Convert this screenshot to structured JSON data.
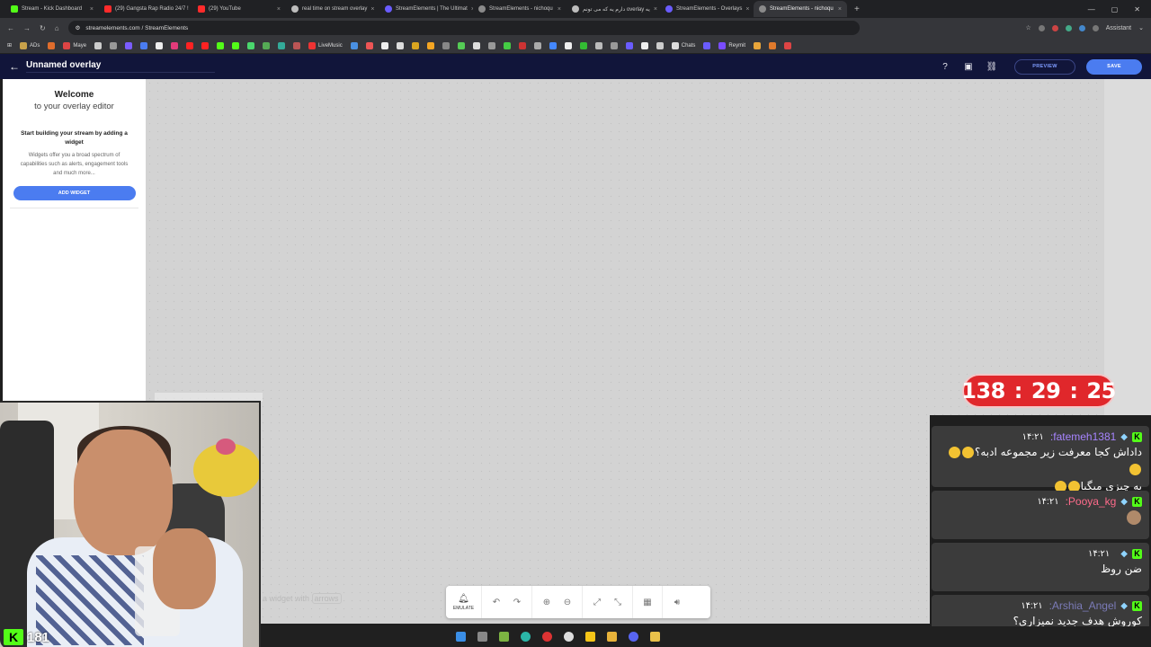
{
  "browser": {
    "tabs": [
      {
        "label": "Stream - Kick Dashboard",
        "color": "#53fc18"
      },
      {
        "label": "(29) Gangsta Rap Radio 24/7 !",
        "color": "#ff2b2b"
      },
      {
        "label": "(29) YouTube",
        "color": "#ff2b2b"
      },
      {
        "label": "real time on stream overlay",
        "color": "#bdbdbd"
      },
      {
        "label": "StreamElements | The Ultimat",
        "color": "#6a5cff"
      },
      {
        "label": "StreamElements - nichoqu",
        "color": "#8a8a8a"
      },
      {
        "label": "دارم یه که می تونم overlay يه",
        "color": "#bdbdbd"
      },
      {
        "label": "StreamElements - Overlays",
        "color": "#6a5cff"
      },
      {
        "label": "StreamElements - nichoqu",
        "color": "#8a8a8a"
      }
    ],
    "active_tab": 8,
    "url": "streamelements.com / StreamElements",
    "assistant_label": "Assistant",
    "bookmarks": [
      "ADs",
      "Maye",
      "LiveMusic",
      "Chats",
      "Reymit"
    ]
  },
  "app": {
    "overlay_name": "Unnamed overlay",
    "preview_label": "PREVIEW",
    "save_label": "SAVE"
  },
  "panel": {
    "welcome_title": "Welcome",
    "welcome_sub": "to your overlay editor",
    "heading": "Start building your stream by adding a widget",
    "description": "Widgets offer you a broad spectrum of capabilities such as alerts, engagement tools and much more...",
    "add_widget_label": "ADD WIDGET"
  },
  "canvas": {
    "hint_prefix": "a widget with",
    "hint_kbd": "arrows",
    "emulate_label": "EMULATE"
  },
  "timer": {
    "hours": "138",
    "minutes": "29",
    "seconds": "25",
    "separator": ":"
  },
  "chat": {
    "messages": [
      {
        "time": "۱۴:۲۱",
        "user": ":fatemeh1381",
        "user_color": "#a784ff",
        "text": "داداش کجا معرفت زیر مجموعه ادبه؟",
        "text2": "یه چیزی میگیا"
      },
      {
        "time": "۱۴:۲۱",
        "user": ":Pooya_kg",
        "user_color": "#ff6b8b",
        "text": "",
        "text2": ""
      },
      {
        "time": "۱۴:۲۱",
        "user": "",
        "user_color": "#ffffff",
        "text": "ضن روظ",
        "text2": ""
      },
      {
        "time": "۱۴:۲۱",
        "user": ":Arshia_Angel",
        "user_color": "#7b7bb8",
        "text": "کوروش هدف جدید نمیزاری؟",
        "text2": ""
      }
    ]
  },
  "stream": {
    "viewer_count": "181"
  }
}
